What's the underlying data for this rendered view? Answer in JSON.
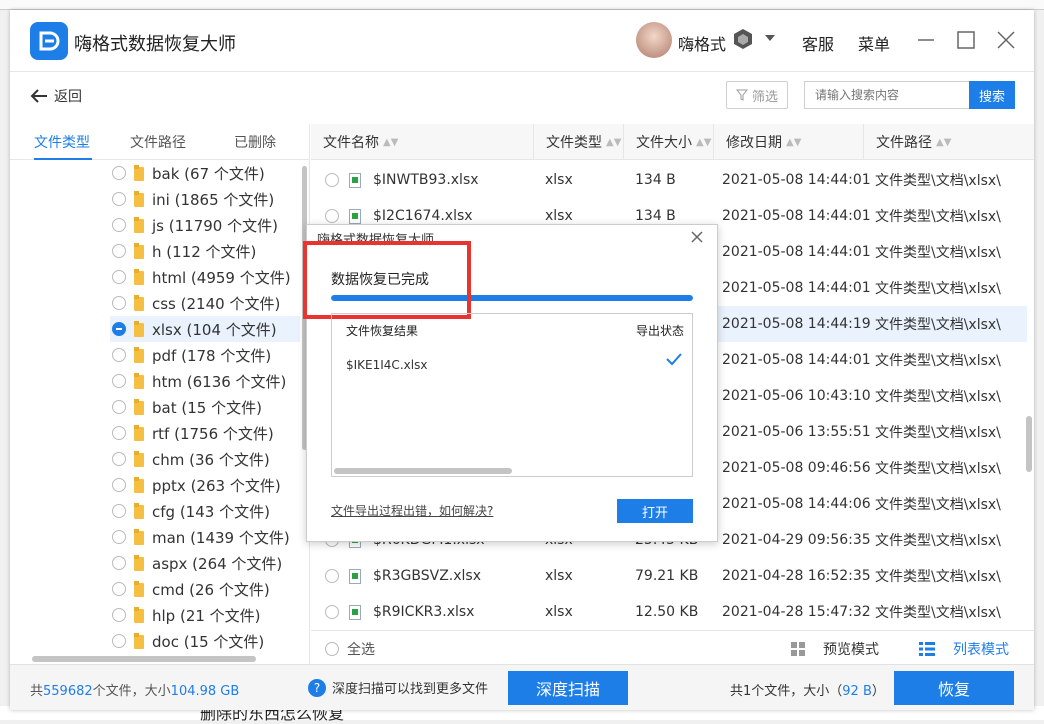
{
  "app": {
    "title": "嗨格式数据恢复大师",
    "username": "嗨格式",
    "service_label": "客服",
    "menu_label": "菜单"
  },
  "toolbar": {
    "back_label": "返回",
    "filter_label": "筛选",
    "search_placeholder": "请输入搜索内容",
    "search_button": "搜索"
  },
  "tabs": [
    {
      "label": "文件类型",
      "active": true
    },
    {
      "label": "文件路径",
      "active": false
    },
    {
      "label": "已删除",
      "active": false
    }
  ],
  "tree": [
    {
      "label": "bak (67 个文件)"
    },
    {
      "label": "ini (1865 个文件)"
    },
    {
      "label": "js (11790 个文件)"
    },
    {
      "label": "h (112 个文件)"
    },
    {
      "label": "html (4959 个文件)"
    },
    {
      "label": "css (2140 个文件)"
    },
    {
      "label": "xlsx (104 个文件)",
      "selected": true
    },
    {
      "label": "pdf (178 个文件)"
    },
    {
      "label": "htm (6136 个文件)"
    },
    {
      "label": "bat (15 个文件)"
    },
    {
      "label": "rtf (1756 个文件)"
    },
    {
      "label": "chm (36 个文件)"
    },
    {
      "label": "pptx (263 个文件)"
    },
    {
      "label": "cfg (143 个文件)"
    },
    {
      "label": "man (1439 个文件)"
    },
    {
      "label": "aspx (264 个文件)"
    },
    {
      "label": "cmd (26 个文件)"
    },
    {
      "label": "hlp (21 个文件)"
    },
    {
      "label": "doc (15 个文件)"
    }
  ],
  "table": {
    "columns": [
      "文件名称",
      "文件类型",
      "文件大小",
      "修改日期",
      "文件路径"
    ],
    "rows": [
      {
        "name": "$INWTB93.xlsx",
        "type": "xlsx",
        "size": "134 B",
        "date": "2021-05-08 14:44:01",
        "path": "文件类型\\文档\\xlsx\\"
      },
      {
        "name": "$I2C1674.xlsx",
        "type": "xlsx",
        "size": "134 B",
        "date": "2021-05-08 14:44:01",
        "path": "文件类型\\文档\\xlsx\\"
      },
      {
        "name": "",
        "type": "",
        "size": "",
        "date": "2021-05-08 14:44:01",
        "path": "文件类型\\文档\\xlsx\\"
      },
      {
        "name": "",
        "type": "",
        "size": "",
        "date": "2021-05-08 14:44:01",
        "path": "文件类型\\文档\\xlsx\\"
      },
      {
        "name": "",
        "type": "",
        "size": "",
        "date": "2021-05-08 14:44:19",
        "path": "文件类型\\文档\\xlsx\\",
        "highlight": true
      },
      {
        "name": "",
        "type": "",
        "size": "",
        "date": "2021-05-08 14:44:01",
        "path": "文件类型\\文档\\xlsx\\"
      },
      {
        "name": "",
        "type": "",
        "size": "",
        "date": "2021-05-06 10:43:10",
        "path": "文件类型\\文档\\xlsx\\"
      },
      {
        "name": "",
        "type": "",
        "size": "",
        "date": "2021-05-06 13:55:51",
        "path": "文件类型\\文档\\xlsx\\"
      },
      {
        "name": "",
        "type": "",
        "size": "",
        "date": "2021-05-08 09:46:56",
        "path": "文件类型\\文档\\xlsx\\"
      },
      {
        "name": "",
        "type": "",
        "size": "",
        "date": "2021-05-08 14:44:06",
        "path": "文件类型\\文档\\xlsx\\"
      },
      {
        "name": "$R6KDGM1.xlsx",
        "type": "xlsx",
        "size": "25.45 KB",
        "date": "2021-04-29 09:56:35",
        "path": "文件类型\\文档\\xlsx\\"
      },
      {
        "name": "$R3GBSVZ.xlsx",
        "type": "xlsx",
        "size": "79.21 KB",
        "date": "2021-04-28 16:52:35",
        "path": "文件类型\\文档\\xlsx\\"
      },
      {
        "name": "$R9ICKR3.xlsx",
        "type": "xlsx",
        "size": "12.50 KB",
        "date": "2021-04-28 15:47:32",
        "path": "文件类型\\文档\\xlsx\\"
      }
    ]
  },
  "footer": {
    "select_all": "全选",
    "preview_mode": "预览模式",
    "list_mode": "列表模式"
  },
  "status": {
    "total_prefix": "共",
    "total_count": "559682",
    "total_mid": "个文件，大小",
    "total_size": "104.98 GB",
    "hint": "深度扫描可以找到更多文件",
    "deep_scan": "深度扫描",
    "selected_prefix": "共1个文件，大小（",
    "selected_size": "92 B",
    "selected_suffix": "）",
    "recover": "恢复"
  },
  "dialog": {
    "title": "嗨格式数据恢复大师",
    "status": "数据恢复已完成",
    "progress": 1.0,
    "result_header": "文件恢复结果",
    "export_header": "导出状态",
    "file": "$IKE1I4C.xlsx",
    "help_link": "文件导出过程出错，如何解决?",
    "open_button": "打开"
  },
  "background_doc": {
    "text": "删除的东西怎么恢复"
  },
  "colors": {
    "accent": "#1e7ee8",
    "highlight_box": "#e8332f"
  }
}
